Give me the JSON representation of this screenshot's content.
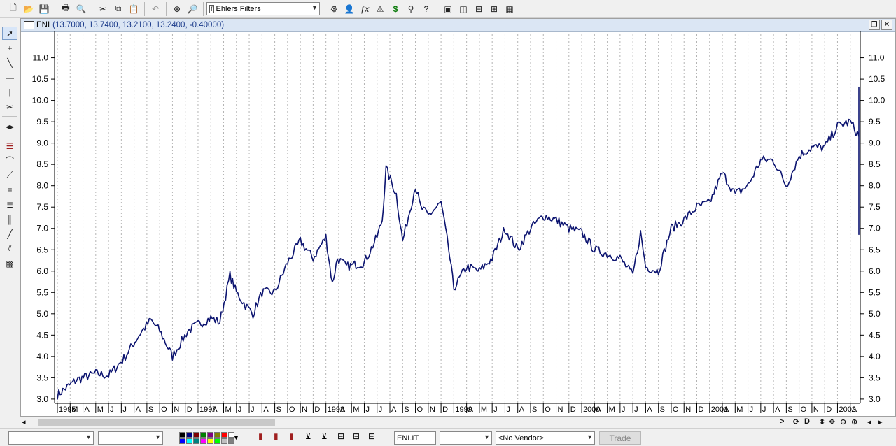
{
  "toolbar": {
    "indicator_select": "Ehlers Filters",
    "icons": [
      "new-icon",
      "open-icon",
      "save-icon",
      "print-icon",
      "print-preview-icon",
      "cut-icon",
      "copy-icon",
      "paste-icon",
      "undo-icon",
      "crosshair-icon",
      "zoom-icon",
      "indicator-icon",
      "expert-icon",
      "function-icon",
      "system-icon",
      "dollar-icon",
      "binoculars-icon",
      "help-icon",
      "window-icon",
      "tile-vertical-icon",
      "tile-horizontal-icon",
      "tile-icon",
      "layout-icon"
    ]
  },
  "chart_window": {
    "symbol": "ENI",
    "values": "(13.7000, 13.7400, 13.2100, 13.2400, -0.40000)"
  },
  "chart_data": {
    "type": "line",
    "title": "",
    "xlabel": "",
    "ylabel": "",
    "ylim": [
      2.9,
      11.55
    ],
    "y_ticks": [
      "3.0",
      "3.5",
      "4.0",
      "4.5",
      "5.0",
      "5.5",
      "6.0",
      "6.5",
      "7.0",
      "7.5",
      "8.0",
      "8.5",
      "9.0",
      "9.5",
      "10.0",
      "10.5",
      "11.0"
    ],
    "x_ticks": [
      "1995",
      "M",
      "A",
      "M",
      "J",
      "J",
      "A",
      "S",
      "O",
      "N",
      "D",
      "1997",
      "A",
      "M",
      "J",
      "J",
      "A",
      "S",
      "O",
      "N",
      "D",
      "1998",
      "A",
      "M",
      "J",
      "J",
      "A",
      "S",
      "O",
      "N",
      "D",
      "1999",
      "A",
      "M",
      "J",
      "J",
      "A",
      "S",
      "O",
      "N",
      "D",
      "2000",
      "A",
      "M",
      "J",
      "J",
      "A",
      "S",
      "O",
      "N",
      "D",
      "2001",
      "A",
      "M",
      "J",
      "J",
      "A",
      "S",
      "O",
      "N",
      "D",
      "2002",
      "A"
    ],
    "grid": true,
    "series": [
      {
        "values": [
          [
            0,
            3.1
          ],
          [
            1.5,
            3.45
          ],
          [
            3,
            3.6
          ],
          [
            4,
            3.55
          ],
          [
            5.2,
            3.95
          ],
          [
            6.5,
            4.55
          ],
          [
            7.3,
            4.85
          ],
          [
            8,
            4.6
          ],
          [
            9,
            4.0
          ],
          [
            9.6,
            4.3
          ],
          [
            10.2,
            4.6
          ],
          [
            11,
            4.75
          ],
          [
            12,
            4.9
          ],
          [
            12.7,
            4.8
          ],
          [
            13.5,
            5.9
          ],
          [
            14,
            5.5
          ],
          [
            14.7,
            5.2
          ],
          [
            15.3,
            5.0
          ],
          [
            16,
            5.5
          ],
          [
            17,
            5.5
          ],
          [
            18,
            6.2
          ],
          [
            19,
            6.7
          ],
          [
            20,
            6.3
          ],
          [
            21,
            6.8
          ],
          [
            21.5,
            5.7
          ],
          [
            21.9,
            6.3
          ],
          [
            22.6,
            6.1
          ],
          [
            24,
            6.2
          ],
          [
            25,
            6.8
          ],
          [
            25.4,
            7.2
          ],
          [
            25.7,
            8.4
          ],
          [
            26.5,
            7.8
          ],
          [
            27,
            6.7
          ],
          [
            28,
            8.0
          ],
          [
            28.4,
            7.5
          ],
          [
            29,
            7.3
          ],
          [
            30,
            7.6
          ],
          [
            30.6,
            6.5
          ],
          [
            31,
            5.6
          ],
          [
            32,
            6.1
          ],
          [
            33,
            6.0
          ],
          [
            34,
            6.3
          ],
          [
            35,
            7.0
          ],
          [
            36,
            6.5
          ],
          [
            37,
            7.0
          ],
          [
            38,
            7.3
          ],
          [
            39,
            7.2
          ],
          [
            40,
            7.0
          ],
          [
            41,
            6.9
          ],
          [
            42,
            6.5
          ],
          [
            43,
            6.4
          ],
          [
            44,
            6.3
          ],
          [
            45,
            5.9
          ],
          [
            45.6,
            6.9
          ],
          [
            46,
            6.1
          ],
          [
            47,
            6.0
          ],
          [
            48,
            7.0
          ],
          [
            49,
            7.2
          ],
          [
            50,
            7.5
          ],
          [
            51,
            7.6
          ],
          [
            52,
            8.3
          ],
          [
            53,
            7.8
          ],
          [
            54,
            8.0
          ],
          [
            55,
            8.6
          ],
          [
            56,
            8.6
          ],
          [
            57,
            8.0
          ],
          [
            58,
            8.7
          ],
          [
            59,
            8.9
          ],
          [
            60,
            8.9
          ],
          [
            61,
            9.4
          ],
          [
            62,
            9.5
          ],
          [
            63,
            9.0
          ],
          [
            64,
            8.3
          ],
          [
            65,
            8.8
          ],
          [
            66,
            8.5
          ],
          [
            66.5,
            6.9
          ],
          [
            67,
            8.1
          ],
          [
            68,
            8.6
          ],
          [
            69,
            7.8
          ],
          [
            70,
            8.1
          ],
          [
            71,
            8.4
          ],
          [
            72,
            9.4
          ],
          [
            73,
            10.2
          ],
          [
            73.5,
            9.8
          ],
          [
            74,
            10.1
          ]
        ]
      }
    ]
  },
  "scrollbar": {
    "nav_buttons": [
      ">",
      "D",
      "D"
    ]
  },
  "bottombar": {
    "symbol_field": "ENI.IT",
    "interval_select": "",
    "vendor_select": "<No Vendor>",
    "trade_label": "Trade",
    "swatch_colors": [
      "#000000",
      "#000080",
      "#800000",
      "#008000",
      "#800080",
      "#808000",
      "#ff0000",
      "#ffffff",
      "#0000ff",
      "#00ffff",
      "#008080",
      "#ff00ff",
      "#ffff00",
      "#00ff00",
      "#c0c0c0",
      "#808080"
    ]
  }
}
